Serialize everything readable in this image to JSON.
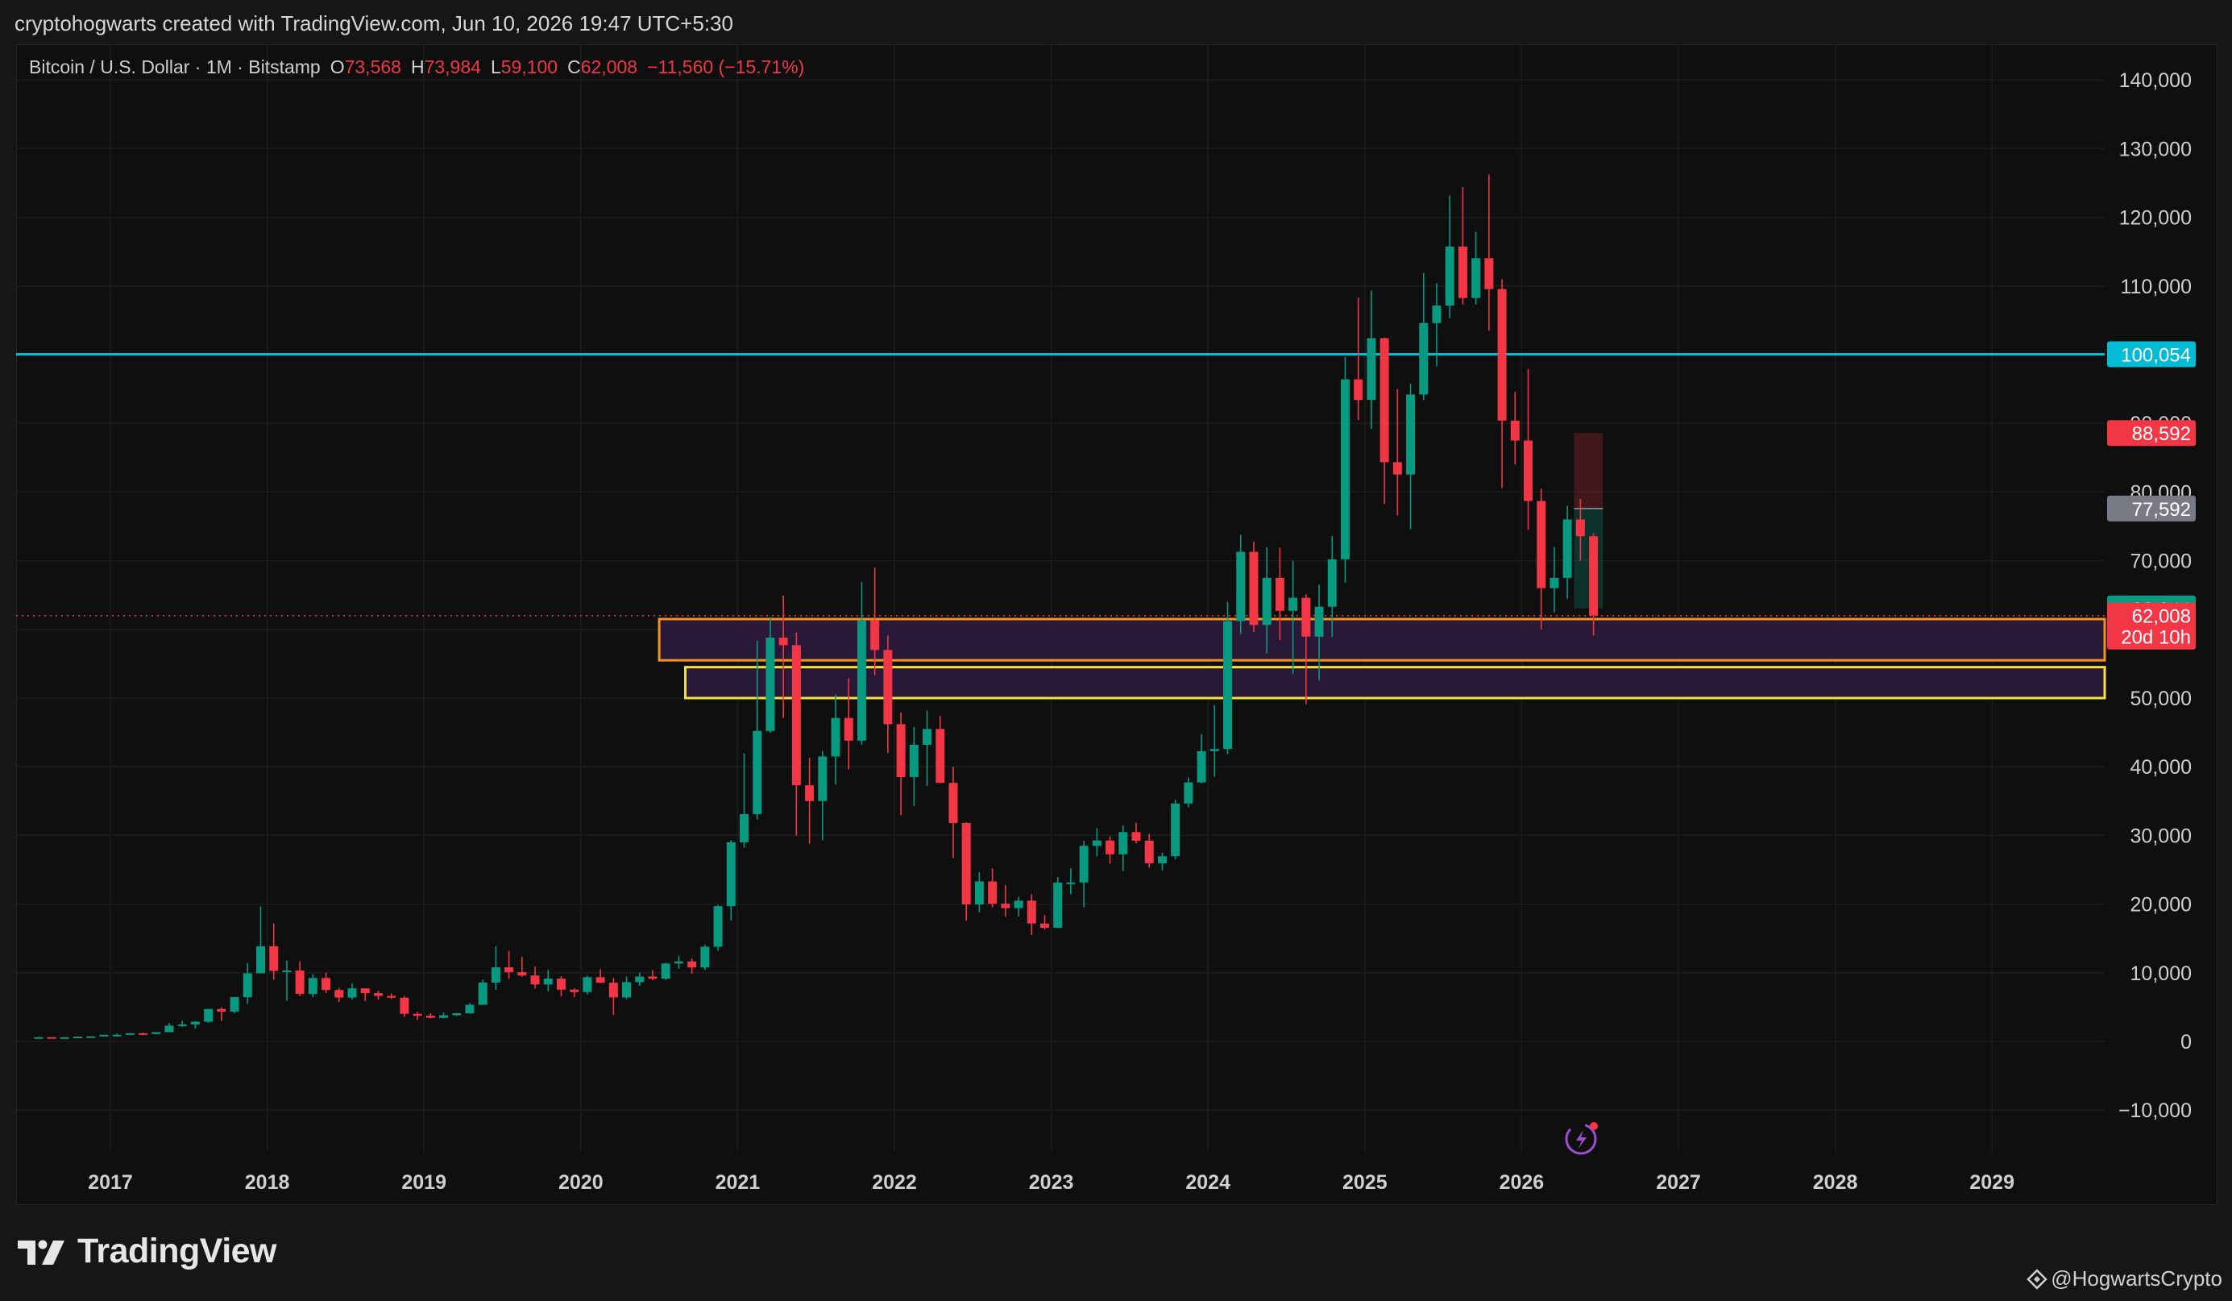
{
  "header": {
    "caption": "cryptohogwarts created with TradingView.com, Jun 10, 2026 19:47 UTC+5:30"
  },
  "legend": {
    "symbol": "Bitcoin / U.S. Dollar · 1M · Bitstamp",
    "open_label": "O",
    "open": "73,568",
    "high_label": "H",
    "high": "73,984",
    "low_label": "L",
    "low": "59,100",
    "close_label": "C",
    "close": "62,008",
    "change": "−11,560 (−15.71%)"
  },
  "branding": {
    "logo_text": "TradingView",
    "attribution": "@HogwartsCrypto"
  },
  "colors": {
    "up": "#089981",
    "down": "#f23645",
    "cyan_line": "#00bcd4",
    "orange_zone": "#f7931a",
    "yellow_zone": "#f5e03d",
    "zone_fill": "#2e1a3c",
    "grid": "#1d1d1d",
    "axis_text": "#cfcfcf"
  },
  "chart_data": {
    "type": "candlestick",
    "title": "Bitcoin / U.S. Dollar · 1M · Bitstamp",
    "xlabel": "",
    "ylabel": "",
    "xlim": [
      "2016-07",
      "2029-12"
    ],
    "ylim": [
      -17000,
      145000
    ],
    "y_ticks": [
      -10000,
      0,
      10000,
      20000,
      30000,
      40000,
      50000,
      60000,
      70000,
      80000,
      90000,
      100000,
      110000,
      120000,
      130000,
      140000
    ],
    "y_tick_labels": [
      "−10,000",
      "0",
      "10,000",
      "20,000",
      "30,000",
      "40,000",
      "50,000",
      "60,000",
      "70,000",
      "80,000",
      "90,000",
      "100,000",
      "110,000",
      "120,000",
      "130,000",
      "140,000"
    ],
    "x_ticks": [
      "2017",
      "2018",
      "2019",
      "2020",
      "2021",
      "2022",
      "2023",
      "2024",
      "2025",
      "2026",
      "2027",
      "2028",
      "2029"
    ],
    "grid": true,
    "candles": [
      [
        "2016-07",
        620,
        680,
        600,
        625
      ],
      [
        "2016-08",
        625,
        630,
        540,
        575
      ],
      [
        "2016-09",
        575,
        630,
        570,
        610
      ],
      [
        "2016-10",
        610,
        720,
        600,
        700
      ],
      [
        "2016-11",
        700,
        760,
        690,
        745
      ],
      [
        "2016-12",
        745,
        980,
        740,
        965
      ],
      [
        "2017-01",
        965,
        1150,
        750,
        970
      ],
      [
        "2017-02",
        970,
        1200,
        920,
        1190
      ],
      [
        "2017-03",
        1190,
        1300,
        890,
        1080
      ],
      [
        "2017-04",
        1080,
        1350,
        1060,
        1350
      ],
      [
        "2017-05",
        1350,
        2700,
        1350,
        2300
      ],
      [
        "2017-06",
        2300,
        3000,
        2100,
        2480
      ],
      [
        "2017-07",
        2480,
        2950,
        1850,
        2870
      ],
      [
        "2017-08",
        2870,
        4750,
        2700,
        4730
      ],
      [
        "2017-09",
        4730,
        4980,
        2950,
        4340
      ],
      [
        "2017-10",
        4340,
        6470,
        4110,
        6450
      ],
      [
        "2017-11",
        6450,
        11400,
        5500,
        9920
      ],
      [
        "2017-12",
        9920,
        19666,
        9900,
        13860
      ],
      [
        "2018-01",
        13860,
        17200,
        9000,
        10270
      ],
      [
        "2018-02",
        10270,
        11800,
        5900,
        10330
      ],
      [
        "2018-03",
        10330,
        11700,
        6600,
        6930
      ],
      [
        "2018-04",
        6930,
        9800,
        6450,
        9240
      ],
      [
        "2018-05",
        9240,
        9990,
        7050,
        7490
      ],
      [
        "2018-06",
        7490,
        7780,
        5750,
        6390
      ],
      [
        "2018-07",
        6390,
        8490,
        6100,
        7730
      ],
      [
        "2018-08",
        7730,
        7750,
        5880,
        7030
      ],
      [
        "2018-09",
        7030,
        7400,
        6100,
        6630
      ],
      [
        "2018-10",
        6630,
        7000,
        6200,
        6370
      ],
      [
        "2018-11",
        6370,
        6600,
        3600,
        4020
      ],
      [
        "2018-12",
        4020,
        4300,
        3150,
        3740
      ],
      [
        "2019-01",
        3740,
        4100,
        3350,
        3440
      ],
      [
        "2019-02",
        3440,
        4200,
        3370,
        3820
      ],
      [
        "2019-03",
        3820,
        4150,
        3700,
        4100
      ],
      [
        "2019-04",
        4100,
        5600,
        4050,
        5330
      ],
      [
        "2019-05",
        5330,
        9000,
        5300,
        8570
      ],
      [
        "2019-06",
        8570,
        13880,
        7500,
        10800
      ],
      [
        "2019-07",
        10800,
        13200,
        9100,
        10080
      ],
      [
        "2019-08",
        10080,
        12300,
        9400,
        9600
      ],
      [
        "2019-09",
        9600,
        10900,
        7700,
        8300
      ],
      [
        "2019-10",
        8300,
        10400,
        7300,
        9150
      ],
      [
        "2019-11",
        9150,
        9500,
        6550,
        7540
      ],
      [
        "2019-12",
        7540,
        7750,
        6450,
        7190
      ],
      [
        "2020-01",
        7190,
        9580,
        6850,
        9350
      ],
      [
        "2020-02",
        9350,
        10500,
        8500,
        8540
      ],
      [
        "2020-03",
        8540,
        9200,
        3850,
        6410
      ],
      [
        "2020-04",
        6410,
        9450,
        6150,
        8630
      ],
      [
        "2020-05",
        8630,
        10050,
        8100,
        9450
      ],
      [
        "2020-06",
        9450,
        10380,
        8900,
        9140
      ],
      [
        "2020-07",
        9140,
        11450,
        8950,
        11350
      ],
      [
        "2020-08",
        11350,
        12480,
        10600,
        11650
      ],
      [
        "2020-09",
        11650,
        12100,
        9850,
        10780
      ],
      [
        "2020-10",
        10780,
        14100,
        10400,
        13790
      ],
      [
        "2020-11",
        13790,
        19900,
        13200,
        19700
      ],
      [
        "2020-12",
        19700,
        29300,
        17600,
        28990
      ],
      [
        "2021-01",
        28990,
        41950,
        28200,
        33100
      ],
      [
        "2021-02",
        33100,
        58350,
        32300,
        45200
      ],
      [
        "2021-03",
        45200,
        61790,
        44950,
        58800
      ],
      [
        "2021-04",
        58800,
        64900,
        47100,
        57700
      ],
      [
        "2021-05",
        57700,
        59500,
        30000,
        37300
      ],
      [
        "2021-06",
        37300,
        41300,
        28800,
        35000
      ],
      [
        "2021-07",
        35000,
        42300,
        29300,
        41500
      ],
      [
        "2021-08",
        41500,
        50500,
        37400,
        47100
      ],
      [
        "2021-09",
        47100,
        52900,
        39600,
        43800
      ],
      [
        "2021-10",
        43800,
        66900,
        43200,
        61300
      ],
      [
        "2021-11",
        61300,
        69000,
        53300,
        57000
      ],
      [
        "2021-12",
        57000,
        59100,
        42000,
        46200
      ],
      [
        "2022-01",
        46200,
        47900,
        32950,
        38500
      ],
      [
        "2022-02",
        38500,
        45800,
        34300,
        43200
      ],
      [
        "2022-03",
        43200,
        48200,
        37200,
        45500
      ],
      [
        "2022-04",
        45500,
        47400,
        37600,
        37650
      ],
      [
        "2022-05",
        37650,
        40000,
        26700,
        31800
      ],
      [
        "2022-06",
        31800,
        31900,
        17600,
        19950
      ],
      [
        "2022-07",
        19950,
        24650,
        18800,
        23300
      ],
      [
        "2022-08",
        23300,
        25200,
        19550,
        20050
      ],
      [
        "2022-09",
        20050,
        22800,
        18150,
        19420
      ],
      [
        "2022-10",
        19420,
        21050,
        18200,
        20500
      ],
      [
        "2022-11",
        20500,
        21450,
        15480,
        17170
      ],
      [
        "2022-12",
        17170,
        18400,
        16300,
        16550
      ],
      [
        "2023-01",
        16550,
        23950,
        16500,
        23130
      ],
      [
        "2023-02",
        23130,
        25250,
        21400,
        23150
      ],
      [
        "2023-03",
        23150,
        29200,
        19550,
        28480
      ],
      [
        "2023-04",
        28480,
        31050,
        26950,
        29250
      ],
      [
        "2023-05",
        29250,
        29850,
        25900,
        27250
      ],
      [
        "2023-06",
        27250,
        31450,
        24800,
        30480
      ],
      [
        "2023-07",
        30480,
        31850,
        28850,
        29230
      ],
      [
        "2023-08",
        29230,
        30200,
        25300,
        25940
      ],
      [
        "2023-09",
        25940,
        27500,
        24900,
        26970
      ],
      [
        "2023-10",
        26970,
        35200,
        26550,
        34650
      ],
      [
        "2023-11",
        34650,
        38450,
        34100,
        37720
      ],
      [
        "2023-12",
        37720,
        44750,
        37600,
        42280
      ],
      [
        "2024-01",
        42280,
        48970,
        38550,
        42580
      ],
      [
        "2024-02",
        42580,
        64000,
        41850,
        61200
      ],
      [
        "2024-03",
        61200,
        73800,
        59300,
        71300
      ],
      [
        "2024-04",
        71300,
        72800,
        59600,
        60650
      ],
      [
        "2024-05",
        60650,
        71950,
        56500,
        67500
      ],
      [
        "2024-06",
        67500,
        71900,
        58450,
        62700
      ],
      [
        "2024-07",
        62700,
        70000,
        53500,
        64600
      ],
      [
        "2024-08",
        64600,
        65100,
        49100,
        58950
      ],
      [
        "2024-09",
        58950,
        66500,
        52550,
        63300
      ],
      [
        "2024-10",
        63300,
        73600,
        58900,
        70200
      ],
      [
        "2024-11",
        70200,
        99650,
        66800,
        96400
      ],
      [
        "2024-12",
        96400,
        108300,
        90500,
        93400
      ],
      [
        "2025-01",
        93400,
        109350,
        89200,
        102400
      ],
      [
        "2025-02",
        102400,
        102500,
        78250,
        84350
      ],
      [
        "2025-03",
        84350,
        95000,
        76600,
        82550
      ],
      [
        "2025-04",
        82550,
        95750,
        74600,
        94200
      ],
      [
        "2025-05",
        94200,
        111900,
        93400,
        104600
      ],
      [
        "2025-06",
        104600,
        110400,
        98300,
        107150
      ],
      [
        "2025-07",
        107150,
        123200,
        105300,
        115750
      ],
      [
        "2025-08",
        115750,
        124400,
        107300,
        108250
      ],
      [
        "2025-09",
        108250,
        117900,
        107300,
        114050
      ],
      [
        "2025-10",
        114050,
        126200,
        103500,
        109550
      ],
      [
        "2025-11",
        109550,
        111000,
        80600,
        90400
      ],
      [
        "2025-12",
        90400,
        94600,
        84000,
        87500
      ],
      [
        "2026-01",
        87500,
        97900,
        74500,
        78700
      ],
      [
        "2026-02",
        78700,
        80500,
        60000,
        66000
      ],
      [
        "2026-03",
        66000,
        72000,
        62500,
        67500
      ],
      [
        "2026-04",
        67500,
        78000,
        64500,
        76000
      ],
      [
        "2026-05",
        76000,
        79000,
        70000,
        73568
      ],
      [
        "2026-06",
        73568,
        73984,
        59100,
        62008
      ]
    ],
    "horizontal_lines": [
      {
        "value": 100054,
        "label": "100,054",
        "style": "solid",
        "color": "#00bcd4"
      },
      {
        "value": 62008,
        "label": "62,008",
        "style": "dotted",
        "color": "#f23645"
      }
    ],
    "zones": [
      {
        "from": "2020-07",
        "to": "2029-12",
        "top": 61500,
        "bottom": 55500,
        "border": "#f7931a"
      },
      {
        "from": "2020-09",
        "to": "2029-12",
        "top": 54500,
        "bottom": 50000,
        "border": "#f5e03d"
      }
    ],
    "position_tool": {
      "month": "2026-05",
      "entry": 77592,
      "stop": 88592,
      "target": 63044
    },
    "price_labels": [
      {
        "value": 100054,
        "text": "100,054",
        "color": "#00bcd4"
      },
      {
        "value": 88592,
        "text": "88,592",
        "color": "#f23645"
      },
      {
        "value": 77592,
        "text": "77,592",
        "color": "#787b86"
      },
      {
        "value": 63044,
        "text": "63,044",
        "color": "#089981"
      },
      {
        "value": 62008,
        "text": "62,008",
        "sub": "20d 10h",
        "color": "#f23645"
      }
    ]
  }
}
